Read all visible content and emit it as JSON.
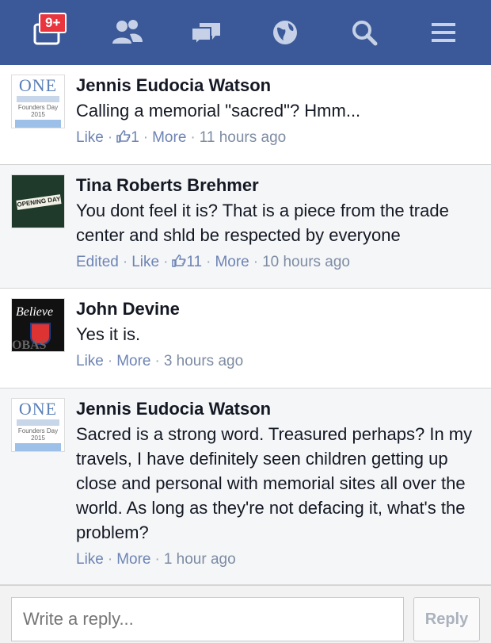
{
  "topbar": {
    "notification_badge": "9+",
    "icons": [
      "notifications-icon",
      "friends-icon",
      "messages-icon",
      "globe-icon",
      "search-icon",
      "menu-icon"
    ]
  },
  "comments": [
    {
      "author": "Jennis Eudocia Watson",
      "text": "Calling a memorial \"sacred\"? Hmm...",
      "edited": "",
      "like": "Like",
      "like_count": "1",
      "more": "More",
      "time": "11 hours ago",
      "avatar_text": {
        "one": "ONE",
        "sub": "Founders Day 2015"
      }
    },
    {
      "author": "Tina Roberts Brehmer",
      "text": "You dont feel it is? That is a piece from the trade center and shld be respected by everyone",
      "edited": "Edited",
      "like": "Like",
      "like_count": "11",
      "more": "More",
      "time": "10 hours ago",
      "avatar_text": {
        "label": "OPENING DAY"
      }
    },
    {
      "author": "John Devine",
      "text": "Yes it is.",
      "like": "Like",
      "more": "More",
      "time": "3 hours ago",
      "avatar_text": {
        "top": "Believe",
        "bottom": "OBAS"
      }
    },
    {
      "author": "Jennis Eudocia Watson",
      "text": "Sacred is a strong word. Treasured perhaps? In my travels, I have definitely seen children getting up close and personal with memorial sites all over the world. As long as they're not defacing it, what's the problem?",
      "like": "Like",
      "more": "More",
      "time": "1 hour ago",
      "avatar_text": {
        "one": "ONE",
        "sub": "Founders Day 2015"
      }
    }
  ],
  "reply": {
    "placeholder": "Write a reply...",
    "button_label": "Reply"
  },
  "colors": {
    "topbar": "#3b5998",
    "badge": "#e8353e",
    "link": "#6d84b4",
    "meta": "#8c9aad"
  }
}
